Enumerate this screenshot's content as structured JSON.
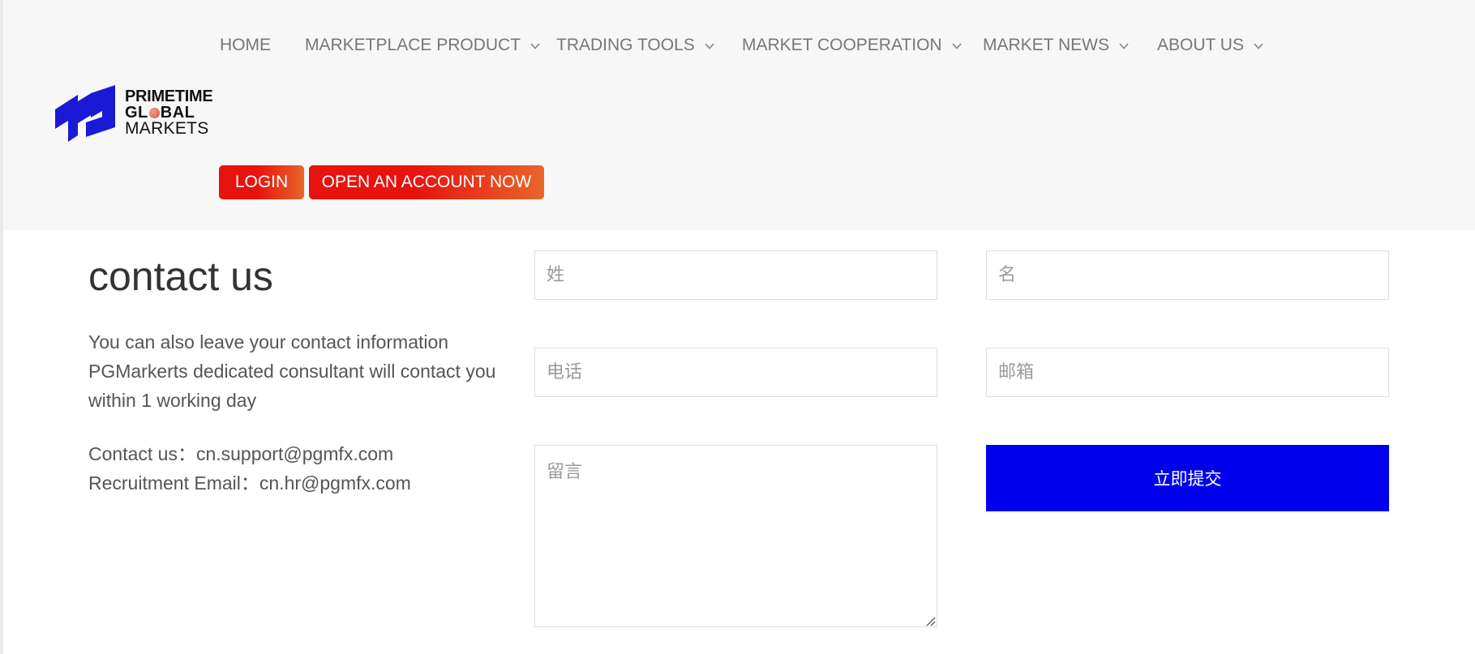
{
  "nav": {
    "items": [
      {
        "label": "HOME"
      },
      {
        "label": "MARKETPLACE PRODUCT"
      },
      {
        "label": "TRADING TOOLS"
      },
      {
        "label": "MARKET COOPERATION"
      },
      {
        "label": "MARKET NEWS"
      },
      {
        "label": "ABOUT US"
      }
    ],
    "chevron_icon": "chevron-down-icon"
  },
  "logo": {
    "line1": "PRIMETIME",
    "line2a": "GL",
    "line2b": "BAL",
    "line3": "MARKETS",
    "mark_color": "#1a1ad6",
    "dot_color": "#e26a5a"
  },
  "actions": {
    "login": "LOGIN",
    "open_account": "OPEN AN ACCOUNT NOW"
  },
  "contact": {
    "title": "contact us",
    "description": "You can also leave your contact information PGMarkerts dedicated consultant will contact you within 1 working day",
    "email_line": "Contact us：cn.support@pgmfx.com",
    "recruit_line": "Recruitment Email：cn.hr@pgmfx.com"
  },
  "form": {
    "surname_placeholder": "姓",
    "name_placeholder": "名",
    "phone_placeholder": "电话",
    "email_placeholder": "邮箱",
    "message_placeholder": "留言",
    "submit_label": "立即提交"
  },
  "colors": {
    "header_bg": "#f7f7f7",
    "accent_red": "#e8120f",
    "accent_orange": "#e8662a",
    "submit_blue": "#0000ee"
  }
}
